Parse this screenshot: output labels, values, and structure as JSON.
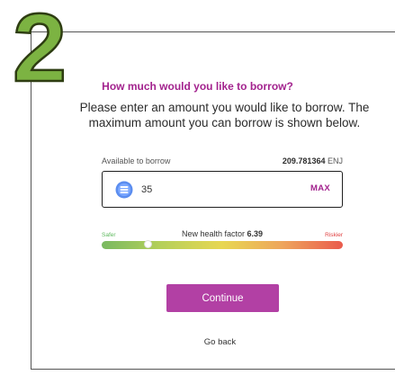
{
  "step": {
    "number": "2",
    "color": "#7cb342"
  },
  "dialog": {
    "title": "How much would you like to borrow?",
    "description": "Please enter an amount you would like to borrow. The maximum amount you can borrow is shown below."
  },
  "available": {
    "label": "Available to borrow",
    "amount": "209.781364",
    "unit": "ENJ"
  },
  "amount_input": {
    "value": "35",
    "token_icon": "enjin-coin-icon",
    "max_label": "MAX"
  },
  "health_factor": {
    "safer_label": "Safer",
    "riskier_label": "Riskier",
    "label": "New health factor",
    "value": "6.39",
    "marker_fraction": 0.18
  },
  "actions": {
    "continue_label": "Continue",
    "go_back_label": "Go back"
  },
  "colors": {
    "accent": "#a3238e",
    "button": "#b240a4"
  }
}
